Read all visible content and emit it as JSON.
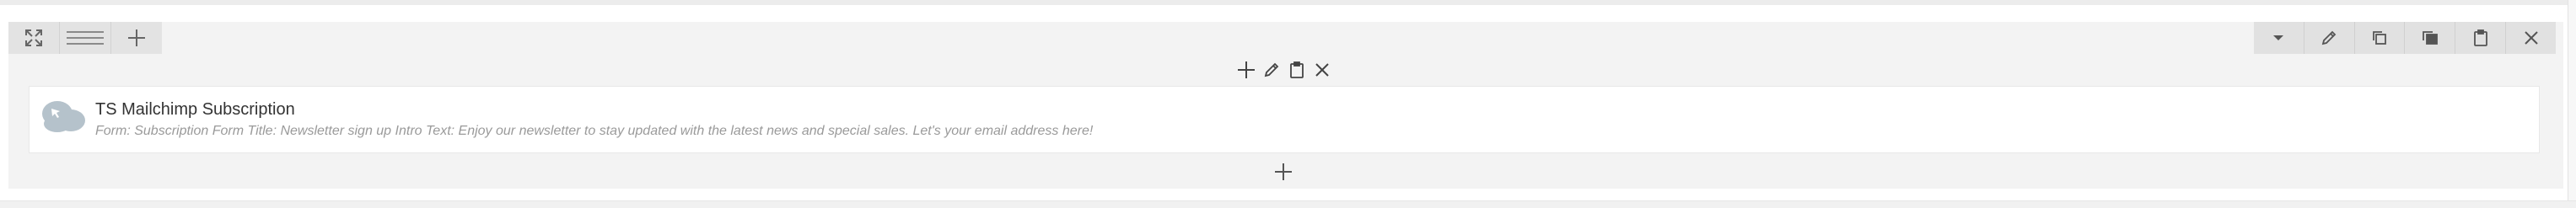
{
  "row_controls": {
    "icons": [
      "fullscreen-icon",
      "drag-handle-icon",
      "plus-icon"
    ]
  },
  "column_controls": {
    "icons": [
      "dropdown-arrow-icon",
      "pencil-icon",
      "copy-icon",
      "duplicate-icon",
      "paste-icon",
      "close-icon"
    ]
  },
  "element_toolbar": {
    "icons": [
      "plus-icon",
      "pencil-icon",
      "clipboard-icon",
      "close-icon"
    ]
  },
  "element": {
    "icon": "mailchimp-cloud-icon",
    "title": "TS Mailchimp Subscription",
    "description": "Form: Subscription Form  Title: Newsletter sign up  Intro Text: Enjoy our newsletter to stay updated with the latest news and special sales. Let's your email address here!"
  },
  "add_element": {
    "icon": "plus-icon"
  },
  "colors": {
    "panel": "#f3f3f3",
    "control_bar": "#e1e1e1",
    "icon": "#555555",
    "muted_text": "#9a9a9a",
    "cloud": "#b5c2cb"
  }
}
